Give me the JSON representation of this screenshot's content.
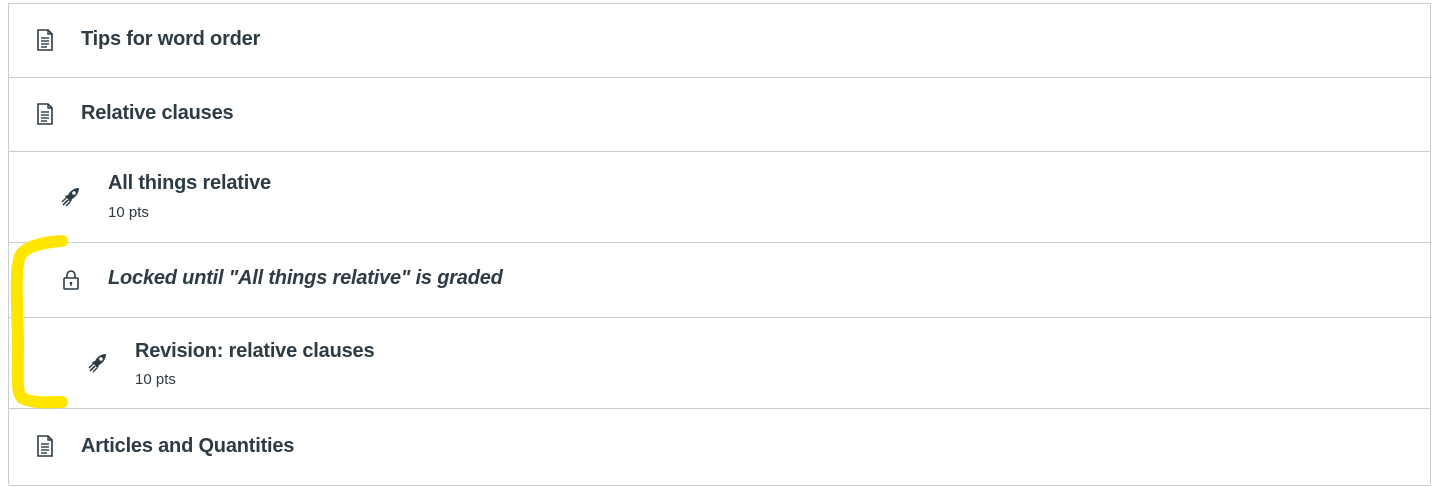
{
  "module_items": [
    {
      "type": "page",
      "icon": "document-icon",
      "title": "Tips for word order"
    },
    {
      "type": "page",
      "icon": "document-icon",
      "title": "Relative clauses"
    },
    {
      "type": "assignment",
      "icon": "rocket-icon",
      "title": "All things relative",
      "points": "10 pts"
    },
    {
      "type": "locked-notice",
      "icon": "lock-icon",
      "text": "Locked until \"All things relative\" is graded"
    },
    {
      "type": "assignment",
      "icon": "rocket-icon",
      "title": "Revision: relative clauses",
      "points": "10 pts"
    },
    {
      "type": "page",
      "icon": "document-icon",
      "title": "Articles and Quantities"
    }
  ],
  "annotation": {
    "color": "#ffe600",
    "shape": "yellow-bracket-highlight"
  }
}
